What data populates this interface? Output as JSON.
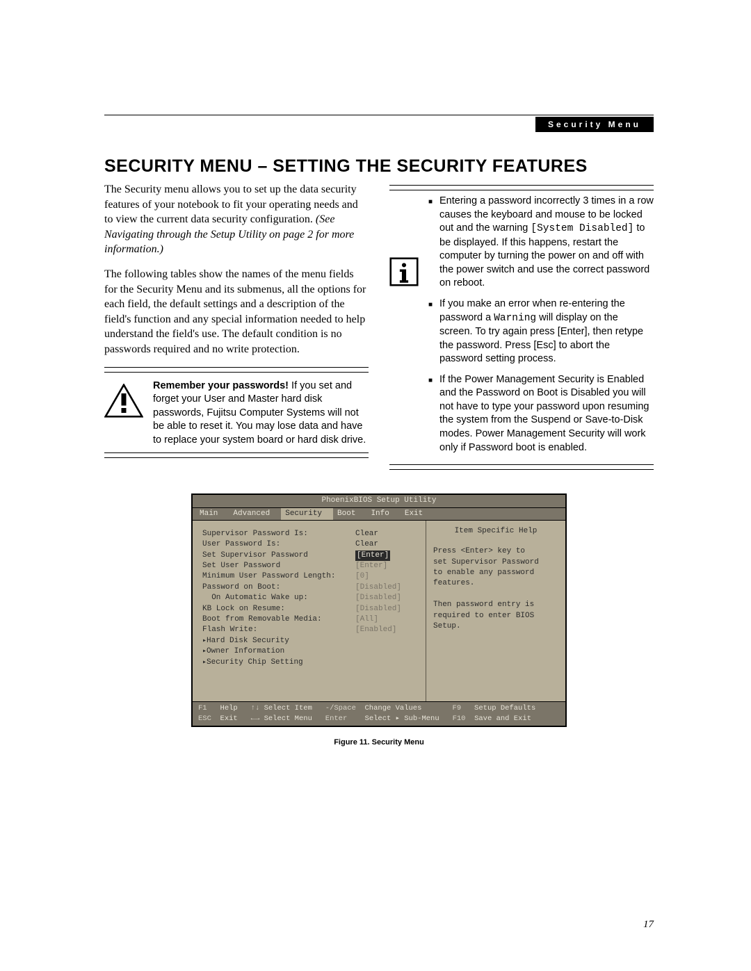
{
  "header": {
    "tag": "Security Menu"
  },
  "title": "SECURITY MENU – SETTING THE SECURITY FEATURES",
  "left": {
    "para1a": "The Security menu allows you to set up the data security features of your notebook to fit your operating needs and to view the current data security configuration. ",
    "para1b": "(See Navigating through the Setup Utility on page 2 for more information.)",
    "para2": "The following tables show the names of the menu fields for the Security Menu and its submenus, all the options for each field, the default settings and a description of the field's function and any special information needed to help understand the field's use. The default condition is no passwords required and no write protection.",
    "warn_bold": "Remember your passwords!",
    "warn_rest": " If you set and forget your User and Master hard disk passwords, Fujitsu Computer Systems will not be able to reset it. You may lose data and have to replace your system board or hard disk drive."
  },
  "right": {
    "b1a": "Entering a password incorrectly 3 times in a row causes the keyboard and mouse to be locked out and the warning ",
    "b1code": "[System Disabled]",
    "b1b": " to be displayed. If this happens, restart the computer by turning the power on and off with the power switch and use the correct password on reboot.",
    "b2a": "If you make an error when re-entering the password a ",
    "b2code": "Warning",
    "b2b": " will display on the screen. To try again press [Enter], then retype the password. Press [Esc] to abort the password setting process.",
    "b3": "If the Power Management Security is Enabled and the Password on Boot is Disabled you will not have to type your password upon resuming the system from the Suspend or Save-to-Disk modes. Power Management Security will work only if Password boot is enabled."
  },
  "bios": {
    "title": "PhoenixBIOS Setup Utility",
    "tabs": [
      "Main",
      "Advanced",
      "Security",
      "Boot",
      "Info",
      "Exit"
    ],
    "active_tab": "Security",
    "help_title": "Item Specific Help",
    "help_text": "Press <Enter> key to\nset Supervisor Password\nto enable any password\nfeatures.\n\nThen password entry is\nrequired to enter BIOS\nSetup.",
    "rows": [
      {
        "label": "Supervisor Password Is:",
        "value": "Clear",
        "dim": false
      },
      {
        "label": "User Password Is:",
        "value": "Clear",
        "dim": false
      },
      {
        "label": "",
        "value": "",
        "dim": false
      },
      {
        "label": "Set Supervisor Password",
        "value": "[Enter]",
        "dim": false,
        "selected": true
      },
      {
        "label": "Set User Password",
        "value": "[Enter]",
        "dim": true
      },
      {
        "label": "Minimum User Password Length:",
        "value": "[0]",
        "dim": true
      },
      {
        "label": "Password on Boot:",
        "value": "[Disabled]",
        "dim": true
      },
      {
        "label": "  On Automatic Wake up:",
        "value": "[Disabled]",
        "dim": true
      },
      {
        "label": "KB Lock on Resume:",
        "value": "[Disabled]",
        "dim": true
      },
      {
        "label": "Boot from Removable Media:",
        "value": "[All]",
        "dim": true
      },
      {
        "label": "Flash Write:",
        "value": "[Enabled]",
        "dim": true
      }
    ],
    "submenus": [
      "Hard Disk Security",
      "Owner Information",
      "Security Chip Setting"
    ],
    "footer": {
      "r1": {
        "k1": "F1",
        "v1": "Help",
        "k2": "↑↓",
        "v2": "Select Item",
        "k3": "-/Space",
        "v3": "Change Values",
        "k4": "F9",
        "v4": "Setup Defaults"
      },
      "r2": {
        "k1": "ESC",
        "v1": "Exit",
        "k2": "←→",
        "v2": "Select Menu",
        "k3": "Enter",
        "v3": "Select ▸ Sub-Menu",
        "k4": "F10",
        "v4": "Save and Exit"
      }
    }
  },
  "caption": "Figure 11.  Security Menu",
  "page_number": "17"
}
